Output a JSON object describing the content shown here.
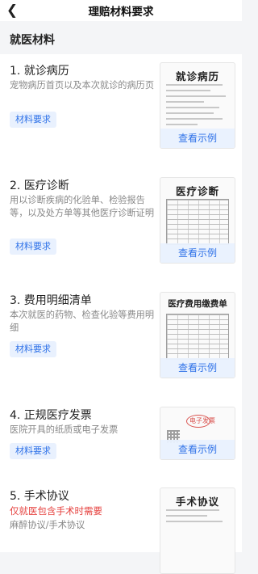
{
  "nav": {
    "title": "理赔材料要求"
  },
  "section": {
    "title": "就医材料"
  },
  "items": [
    {
      "title": "1. 就诊病历",
      "desc": "宠物病历首页以及本次就诊的病历页",
      "tag": "材料要求",
      "thumb_title": "就诊病历",
      "example_label": "查看示例"
    },
    {
      "title": "2. 医疗诊断",
      "desc": "用以诊断疾病的化验单、检验报告等，以及处方单等其他医疗诊断证明",
      "tag": "材料要求",
      "thumb_title": "医疗诊断",
      "example_label": "查看示例"
    },
    {
      "title": "3. 费用明细清单",
      "desc": "本次就医的药物、检查化验等费用明细",
      "tag": "材料要求",
      "thumb_title": "医疗费用缴费单",
      "example_label": "查看示例"
    },
    {
      "title": "4. 正规医疗发票",
      "desc": "医院开具的纸质或电子发票",
      "tag": "材料要求",
      "thumb_title": "电子发票",
      "example_label": "查看示例"
    },
    {
      "title": "5. 手术协议",
      "warning": "仅就医包含手术时需要",
      "desc": "麻醉协议/手术协议",
      "thumb_title": "手术协议"
    }
  ]
}
